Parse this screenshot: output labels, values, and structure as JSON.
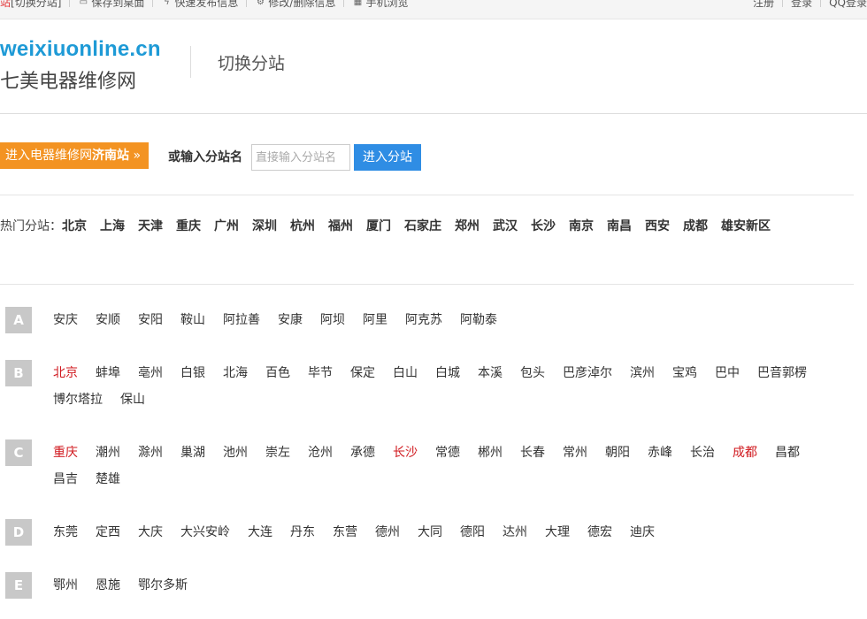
{
  "topbar": {
    "site_name": "站",
    "switch_link": "[切换分站]",
    "links": [
      {
        "icon": "monitor-icon",
        "glyph": "▭",
        "label": "保存到桌面"
      },
      {
        "icon": "lightning-icon",
        "glyph": "ϟ",
        "label": "快速发布信息"
      },
      {
        "icon": "gear-icon",
        "glyph": "⚙",
        "label": "修改/删除信息"
      },
      {
        "icon": "qrcode-icon",
        "glyph": "▦",
        "label": "手机浏览"
      }
    ],
    "right_links": [
      "注册",
      "登录",
      "QQ登录"
    ]
  },
  "header": {
    "domain": "weixiuonline.cn",
    "site_name": "七美电器维修网",
    "page_title": "切换分站"
  },
  "entry": {
    "enter_prefix": "进入电器维修网",
    "enter_city": "济南站",
    "enter_suffix": " »",
    "or_label": "或输入分站名",
    "input_placeholder": "直接输入分站名",
    "input_value": "",
    "go_button": "进入分站"
  },
  "hot": {
    "label": "热门分站：",
    "cities": [
      "北京",
      "上海",
      "天津",
      "重庆",
      "广州",
      "深圳",
      "杭州",
      "福州",
      "厦门",
      "石家庄",
      "郑州",
      "武汉",
      "长沙",
      "南京",
      "南昌",
      "西安",
      "成都",
      "雄安新区"
    ]
  },
  "letters": [
    {
      "letter": "A",
      "cities": [
        {
          "name": "安庆"
        },
        {
          "name": "安顺"
        },
        {
          "name": "安阳"
        },
        {
          "name": "鞍山"
        },
        {
          "name": "阿拉善"
        },
        {
          "name": "安康"
        },
        {
          "name": "阿坝"
        },
        {
          "name": "阿里"
        },
        {
          "name": "阿克苏"
        },
        {
          "name": "阿勒泰"
        }
      ]
    },
    {
      "letter": "B",
      "cities": [
        {
          "name": "北京",
          "highlight": true
        },
        {
          "name": "蚌埠"
        },
        {
          "name": "亳州"
        },
        {
          "name": "白银"
        },
        {
          "name": "北海"
        },
        {
          "name": "百色"
        },
        {
          "name": "毕节"
        },
        {
          "name": "保定"
        },
        {
          "name": "白山"
        },
        {
          "name": "白城"
        },
        {
          "name": "本溪"
        },
        {
          "name": "包头"
        },
        {
          "name": "巴彦淖尔"
        },
        {
          "name": "滨州"
        },
        {
          "name": "宝鸡"
        },
        {
          "name": "巴中"
        },
        {
          "name": "巴音郭楞"
        },
        {
          "name": "博尔塔拉"
        },
        {
          "name": "保山"
        }
      ]
    },
    {
      "letter": "C",
      "cities": [
        {
          "name": "重庆",
          "highlight": true
        },
        {
          "name": "潮州"
        },
        {
          "name": "滁州"
        },
        {
          "name": "巢湖"
        },
        {
          "name": "池州"
        },
        {
          "name": "崇左"
        },
        {
          "name": "沧州"
        },
        {
          "name": "承德"
        },
        {
          "name": "长沙",
          "highlight": true
        },
        {
          "name": "常德"
        },
        {
          "name": "郴州"
        },
        {
          "name": "长春"
        },
        {
          "name": "常州"
        },
        {
          "name": "朝阳"
        },
        {
          "name": "赤峰"
        },
        {
          "name": "长治"
        },
        {
          "name": "成都",
          "highlight": true
        },
        {
          "name": "昌都"
        },
        {
          "name": "昌吉"
        },
        {
          "name": "楚雄"
        }
      ]
    },
    {
      "letter": "D",
      "cities": [
        {
          "name": "东莞"
        },
        {
          "name": "定西"
        },
        {
          "name": "大庆"
        },
        {
          "name": "大兴安岭"
        },
        {
          "name": "大连"
        },
        {
          "name": "丹东"
        },
        {
          "name": "东营"
        },
        {
          "name": "德州"
        },
        {
          "name": "大同"
        },
        {
          "name": "德阳"
        },
        {
          "name": "达州"
        },
        {
          "name": "大理"
        },
        {
          "name": "德宏"
        },
        {
          "name": "迪庆"
        }
      ]
    },
    {
      "letter": "E",
      "cities": [
        {
          "name": "鄂州"
        },
        {
          "name": "恩施"
        },
        {
          "name": "鄂尔多斯"
        }
      ]
    }
  ],
  "colors": {
    "brand_blue": "#1e9ad6",
    "enter_orange": "#f39322",
    "go_blue": "#2f8de4",
    "highlight_red": "#d0181e",
    "badge_gray": "#c8c8c8"
  }
}
